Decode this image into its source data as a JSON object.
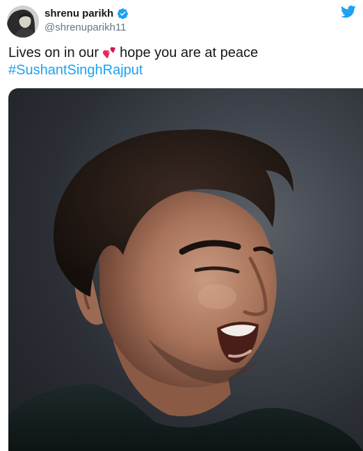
{
  "author": {
    "display_name": "shrenu parikh",
    "handle": "@shrenuparikh11",
    "verified_icon": "verified-badge-icon",
    "avatar_icon": "profile-avatar-icon"
  },
  "platform": {
    "logo_icon": "twitter-bird-icon",
    "brand_color": "#1da1f2"
  },
  "tweet": {
    "text_before_emoji": "Lives on in our",
    "emoji": "revolving-hearts-emoji",
    "text_after_emoji": "hope you are at peace",
    "hashtag": "#SushantSinghRajput"
  },
  "media": {
    "type": "photo",
    "subject_icon": "portrait-photo-icon"
  }
}
